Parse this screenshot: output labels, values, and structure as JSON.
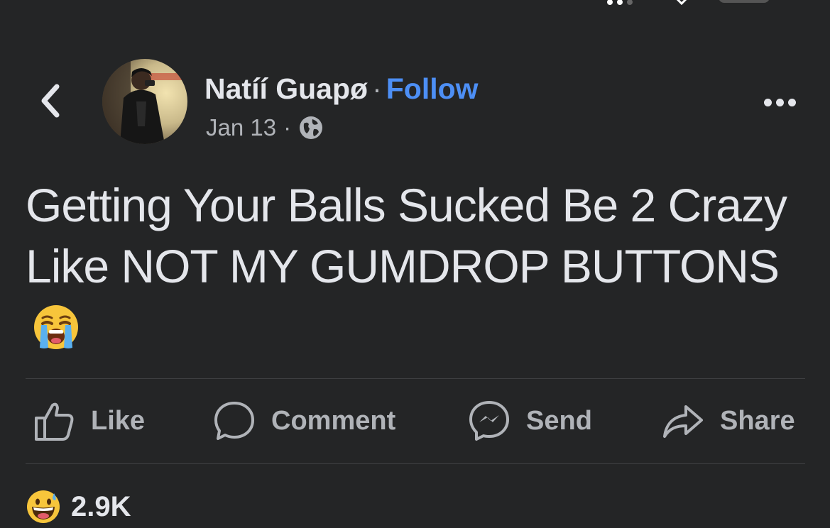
{
  "author": {
    "name": "Natíí Guapø",
    "follow_label": "Follow",
    "separator": "·"
  },
  "meta": {
    "date": "Jan 13",
    "separator": "·",
    "privacy_icon": "globe-icon"
  },
  "post": {
    "text": "Getting Your Balls Sucked Be 2 Crazy Like NOT MY GUMDROP BUTTONS",
    "emoji": "loudly-crying-face"
  },
  "actions": [
    {
      "label": "Like",
      "icon": "thumbs-up-icon"
    },
    {
      "label": "Comment",
      "icon": "comment-bubble-icon"
    },
    {
      "label": "Send",
      "icon": "messenger-icon"
    },
    {
      "label": "Share",
      "icon": "share-arrow-icon"
    }
  ],
  "reactions": {
    "emoji": "grinning-face-with-sweat",
    "count": "2.9K"
  },
  "colors": {
    "background": "#242526",
    "text": "#e4e6eb",
    "secondary": "#b0b3b8",
    "accent": "#4d8ff5",
    "divider": "#3e4042"
  }
}
